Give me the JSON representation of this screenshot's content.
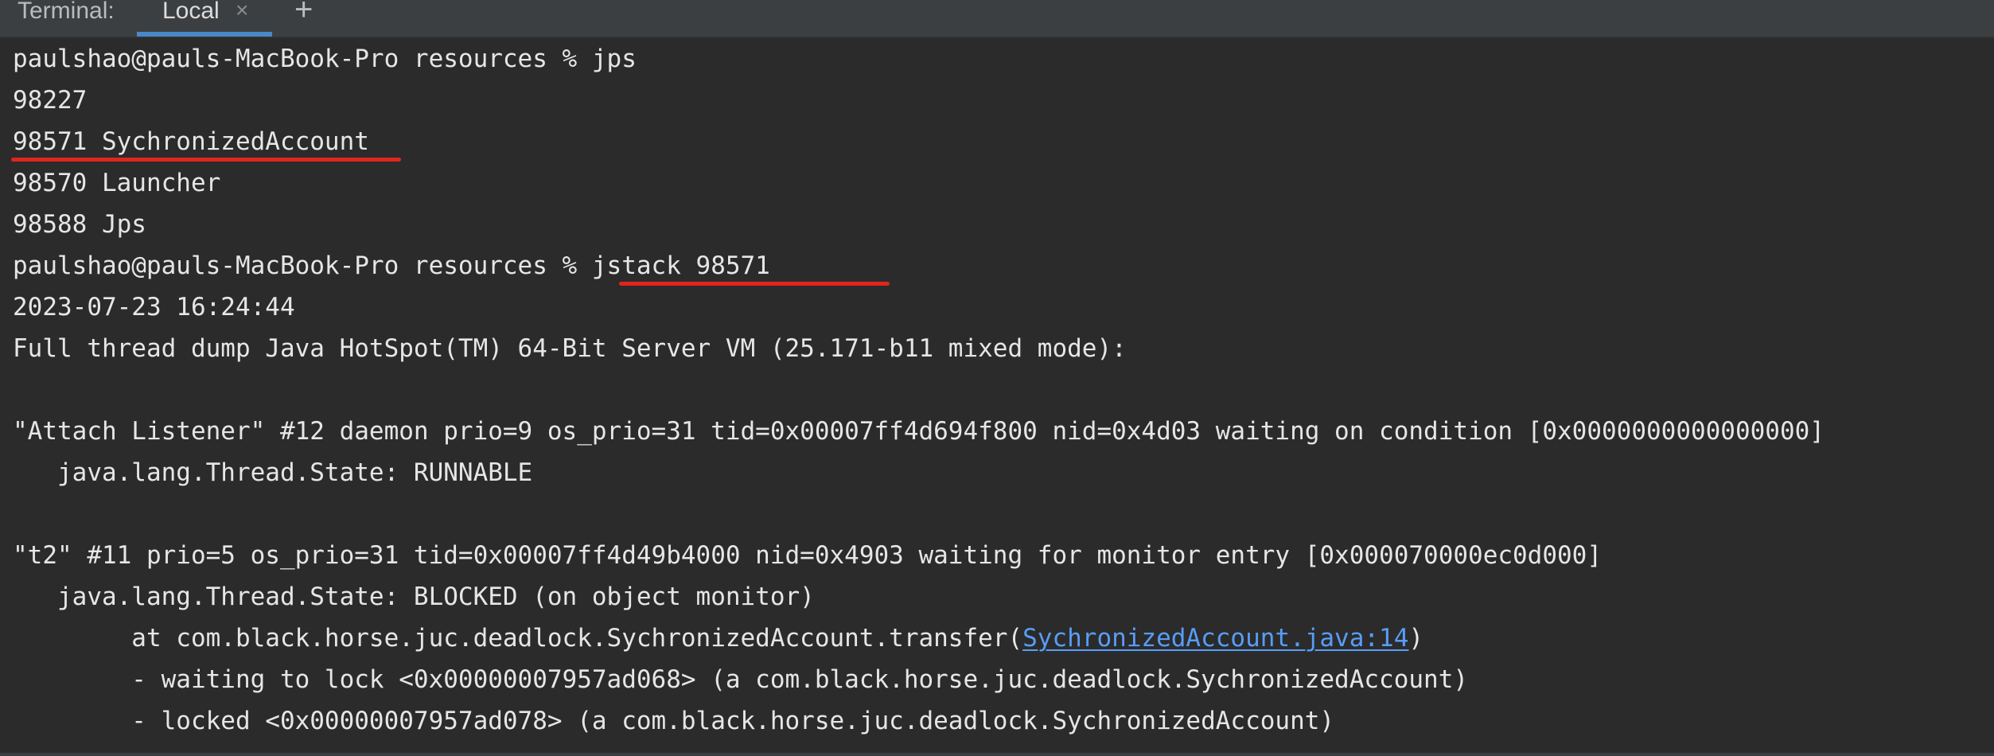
{
  "tabbar": {
    "title": "Terminal:",
    "tab_label": "Local",
    "close_glyph": "×",
    "add_glyph": "+",
    "icons": [
      "close-icon",
      "add-icon"
    ],
    "accent_color": "#4a88c7"
  },
  "terminal": {
    "lines": [
      "paulshao@pauls-MacBook-Pro resources % jps",
      "98227",
      "98571 SychronizedAccount",
      "98570 Launcher",
      "98588 Jps",
      "paulshao@pauls-MacBook-Pro resources % jstack 98571",
      "2023-07-23 16:24:44",
      "Full thread dump Java HotSpot(TM) 64-Bit Server VM (25.171-b11 mixed mode):",
      "",
      "\"Attach Listener\" #12 daemon prio=9 os_prio=31 tid=0x00007ff4d694f800 nid=0x4d03 waiting on condition [0x0000000000000000]",
      "   java.lang.Thread.State: RUNNABLE",
      "",
      "\"t2\" #11 prio=5 os_prio=31 tid=0x00007ff4d49b4000 nid=0x4903 waiting for monitor entry [0x000070000ec0d000]",
      "   java.lang.Thread.State: BLOCKED (on object monitor)",
      "        at com.black.horse.juc.deadlock.SychronizedAccount.transfer(",
      "        - waiting to lock <0x00000007957ad068> (a com.black.horse.juc.deadlock.SychronizedAccount)",
      "        - locked <0x00000007957ad078> (a com.black.horse.juc.deadlock.SychronizedAccount)"
    ],
    "link_text": "SychronizedAccount.java:14",
    "link_suffix": ")",
    "text_color": "#e6e6e6",
    "link_color": "#589df6",
    "annotation_color": "#e0251c"
  }
}
